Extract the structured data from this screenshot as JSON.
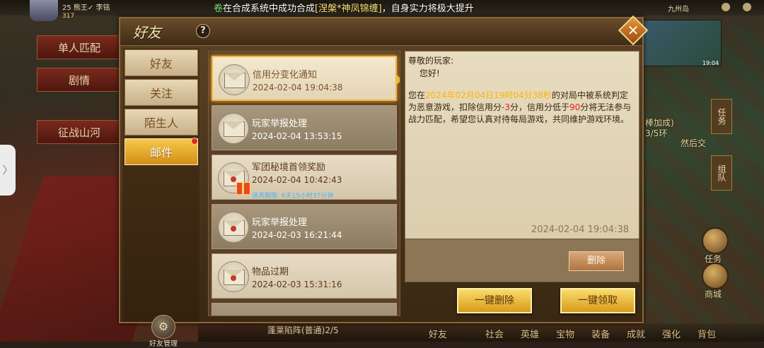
{
  "hud": {
    "level": "25 熊王✓ 李铭",
    "gold": "317",
    "broadcast_tag": "卷",
    "broadcast_pre": "在合成系统中成功合成",
    "broadcast_item": "[涅槃*神凤锦缠]",
    "broadcast_post": "，自身实力将极大提升",
    "location": "九州岛",
    "minimap_time": "19:04"
  },
  "background": {
    "btn_match": "单人匹配",
    "btn_plot": "剧情",
    "btn_war": "征战山河",
    "side_tab_glyph": "〉",
    "right_task": "任务",
    "right_group": "组队",
    "right_labels": [
      "棒加成)",
      "3/5环",
      "然后交"
    ],
    "right_btn1": "任务",
    "right_btn2": "商城",
    "bottom_left": "蓬莱陷阵(普通)2/5",
    "bottom_menu": [
      "好友",
      "社会",
      "英雄",
      "宝物",
      "装备",
      "成就",
      "强化",
      "背包"
    ]
  },
  "panel": {
    "title": "好友",
    "help_label": "?",
    "close_label": "✕",
    "nav": [
      {
        "label": "好友"
      },
      {
        "label": "关注"
      },
      {
        "label": "陌生人"
      },
      {
        "label": "邮件"
      }
    ],
    "friend_manage_label": "好友管理",
    "mails": [
      {
        "title": "信用分变化通知",
        "date": "2024-02-04 19:04:38"
      },
      {
        "title": "玩家举报处理",
        "date": "2024-02-04 13:53:15"
      },
      {
        "title": "军团秘境首领奖励",
        "date": "2024-02-04 10:42:43",
        "expire": "道具期限: 6天15小时37分钟"
      },
      {
        "title": "玩家举报处理",
        "date": "2024-02-03 16:21:44"
      },
      {
        "title": "物品过期",
        "date": "2024-02-03 15:31:16"
      }
    ],
    "content": {
      "greeting": "尊敬的玩家:",
      "hello": "您好!",
      "body_1": "您在",
      "body_time": "2024年02月04日19时04分38秒",
      "body_2": "的对局中被系统判定为恶意游戏，扣除信用分",
      "body_minus": "-3",
      "body_3": "分，信用分低于",
      "body_threshold": "90",
      "body_4": "分将无法参与战力匹配，希望您认真对待每局游戏，共同维护游戏环境。",
      "date": "2024-02-04 19:04:38"
    },
    "delete_label": "删除",
    "delete_all_label": "一键删除",
    "claim_all_label": "一键领取"
  },
  "colors": {
    "accent_gold": "#f2b83e",
    "highlight_yellow": "#ffb400",
    "highlight_red": "#e81e1e",
    "active_tab": "#d48e18"
  }
}
